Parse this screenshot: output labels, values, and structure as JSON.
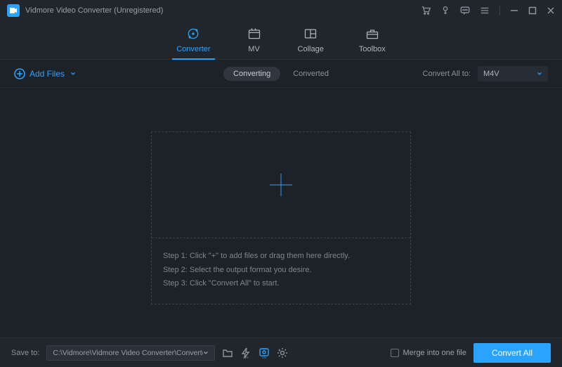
{
  "title": "Vidmore Video Converter (Unregistered)",
  "tabs": {
    "converter": "Converter",
    "mv": "MV",
    "collage": "Collage",
    "toolbox": "Toolbox"
  },
  "subbar": {
    "add_files": "Add Files",
    "converting": "Converting",
    "converted": "Converted",
    "convert_all_to": "Convert All to:",
    "format": "M4V"
  },
  "steps": {
    "s1": "Step 1: Click \"+\" to add files or drag them here directly.",
    "s2": "Step 2: Select the output format you desire.",
    "s3": "Step 3: Click \"Convert All\" to start."
  },
  "bottom": {
    "save_to": "Save to:",
    "path": "C:\\Vidmore\\Vidmore Video Converter\\Converted",
    "merge": "Merge into one file",
    "convert_all": "Convert All"
  }
}
